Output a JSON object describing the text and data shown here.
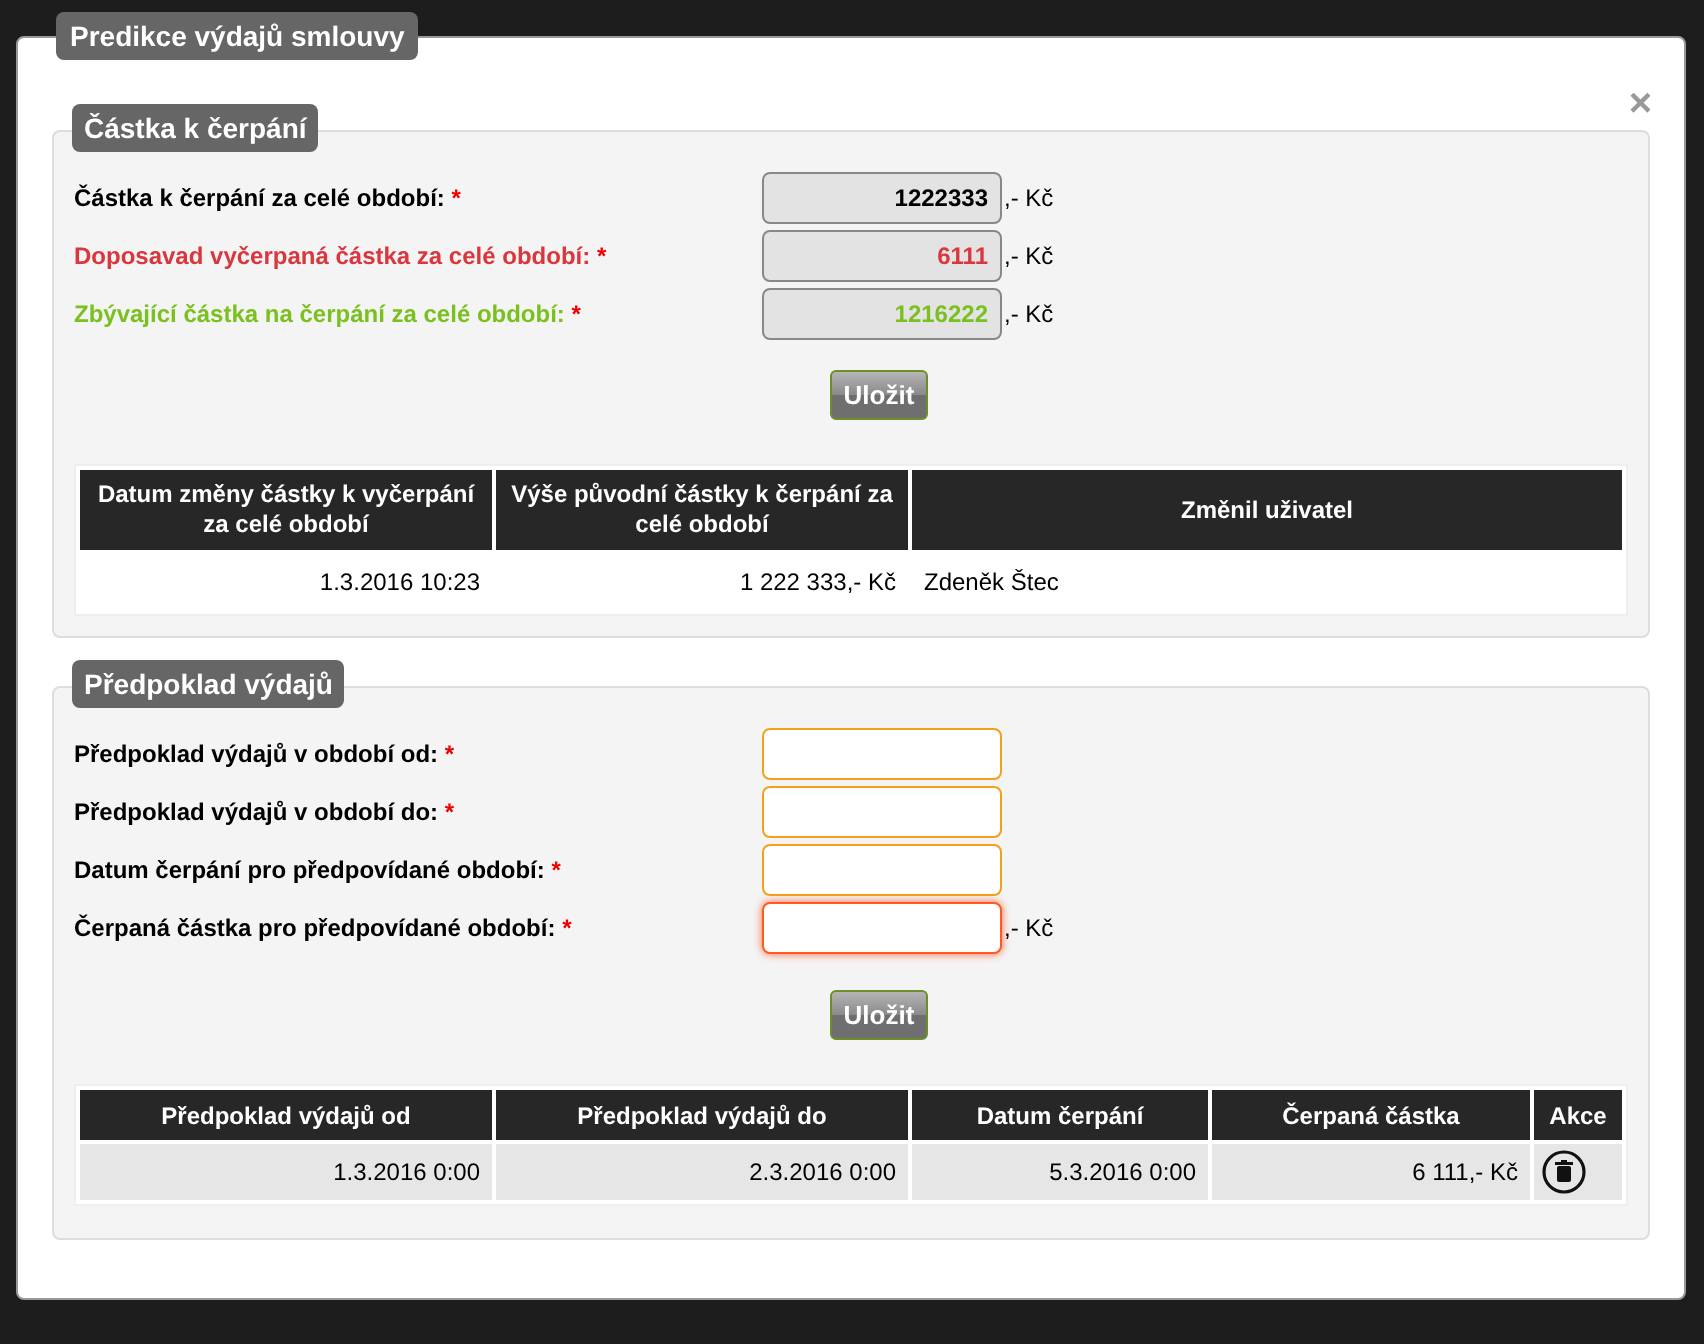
{
  "dialog": {
    "title": "Predikce výdajů smlouvy",
    "close": "×"
  },
  "amount_section": {
    "legend": "Částka k čerpání",
    "rows": [
      {
        "label": "Částka k čerpání za celé období:",
        "required": "*",
        "value": "1222333",
        "unit": ",- Kč",
        "color": "#000000"
      },
      {
        "label": "Doposavad vyčerpaná částka za celé období:",
        "required": "*",
        "value": "6111",
        "unit": ",- Kč",
        "color": "#d9363e"
      },
      {
        "label": "Zbývající částka na čerpání za celé období:",
        "required": "*",
        "value": "1216222",
        "unit": ",- Kč",
        "color": "#7ac01f"
      }
    ],
    "save_button": "Uložit",
    "table": {
      "columns": [
        "Datum změny částky k vyčerpání za celé období",
        "Výše původní částky k čerpání za celé období",
        "Změnil uživatel"
      ],
      "rows": [
        [
          "1.3.2016 10:23",
          "1 222 333,- Kč",
          "Zdeněk Štec"
        ]
      ]
    }
  },
  "forecast_section": {
    "legend": "Předpoklad výdajů",
    "rows": [
      {
        "label": "Předpoklad výdajů v období od:",
        "required": "*",
        "focused": false
      },
      {
        "label": "Předpoklad výdajů v období do:",
        "required": "*",
        "focused": false
      },
      {
        "label": "Datum čerpání pro předpovídané období:",
        "required": "*",
        "focused": false
      },
      {
        "label": "Čerpaná částka pro předpovídané období:",
        "required": "*",
        "unit": ",- Kč",
        "focused": true
      }
    ],
    "save_button": "Uložit",
    "table": {
      "columns": [
        "Předpoklad výdajů od",
        "Předpoklad výdajů do",
        "Datum čerpání",
        "Čerpaná částka",
        "Akce"
      ],
      "rows": [
        [
          "1.3.2016 0:00",
          "2.3.2016 0:00",
          "5.3.2016 0:00",
          "6 111,- Kč"
        ]
      ]
    }
  }
}
